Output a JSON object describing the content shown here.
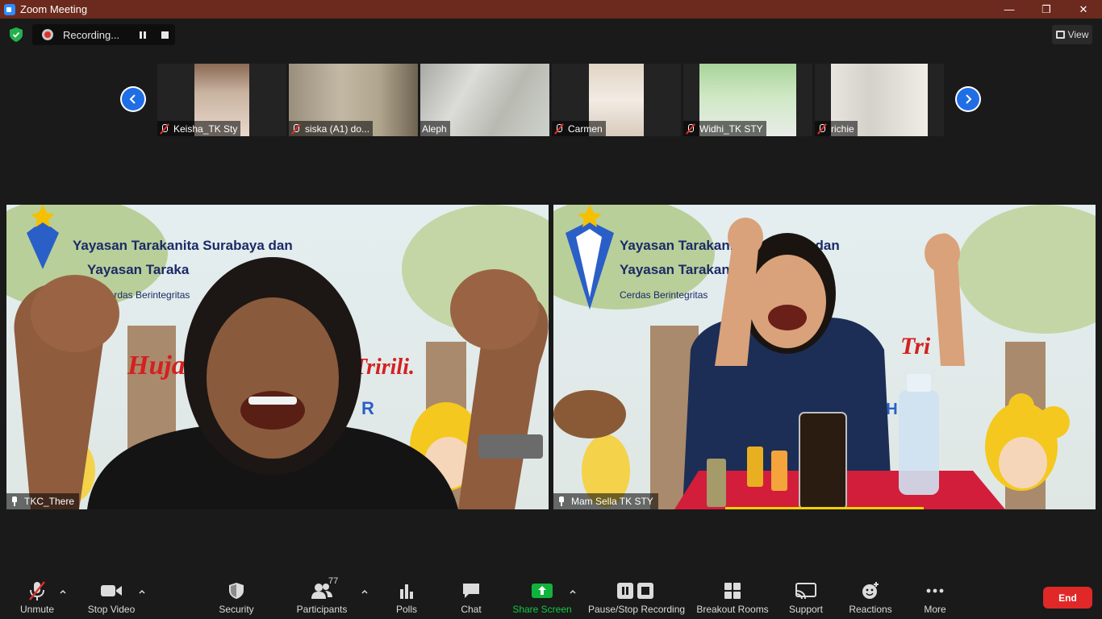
{
  "window": {
    "title": "Zoom Meeting",
    "minimize": "—",
    "restore": "❐",
    "close": "✕"
  },
  "topbar": {
    "recording_label": "Recording...",
    "view_label": "View"
  },
  "thumbnails": [
    {
      "name": "Keisha_TK Sty",
      "muted": true
    },
    {
      "name": "siska (A1) do...",
      "muted": true
    },
    {
      "name": "Aleph",
      "muted": false
    },
    {
      "name": "Carmen",
      "muted": true
    },
    {
      "name": "Widhi_TK STY",
      "muted": true
    },
    {
      "name": "richie",
      "muted": true
    }
  ],
  "main": {
    "left": {
      "name": "TKC_There",
      "banner_line1": "Yayasan Tarakanita Surabaya dan",
      "banner_line2": "Yayasan Taraka",
      "banner_line3": "Cerdas Berintegritas",
      "banner_red": "Huja",
      "banner_red2": "Tririli.",
      "banner_blue": "R"
    },
    "right": {
      "name": "Mam Sella TK STY",
      "banner_line1": "Yayasan Tarakanita Surabaya dan",
      "banner_line2": "Yayasan Tarakanita",
      "banner_line3": "Cerdas Berintegritas",
      "banner_red": "Tri",
      "banner_blue": "HA",
      "banner_blue2": "TH"
    }
  },
  "toolbar": {
    "unmute": "Unmute",
    "stop_video": "Stop Video",
    "security": "Security",
    "participants": "Participants",
    "participants_count": "77",
    "polls": "Polls",
    "chat": "Chat",
    "share_screen": "Share Screen",
    "pause_stop_recording": "Pause/Stop Recording",
    "breakout_rooms": "Breakout Rooms",
    "support": "Support",
    "reactions": "Reactions",
    "more": "More",
    "end": "End"
  },
  "colors": {
    "title_bar": "#6b2a1d",
    "share_green": "#12b33c",
    "end_red": "#e02828",
    "accent_blue": "#1f6ee6"
  }
}
